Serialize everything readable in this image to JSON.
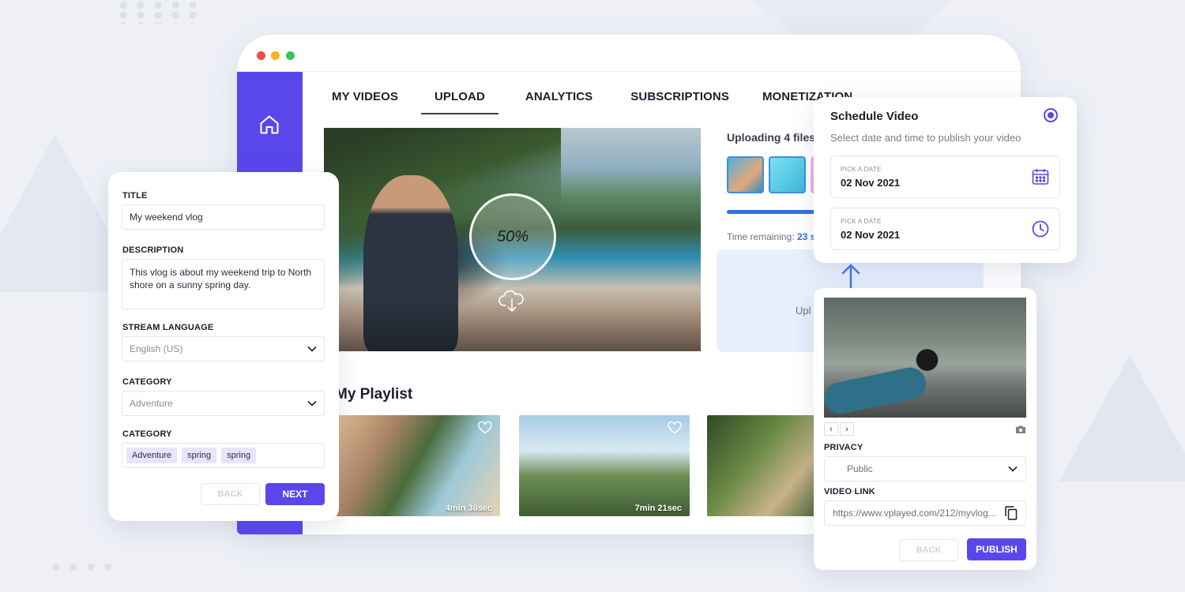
{
  "window": {
    "tabs": [
      {
        "label": "MY VIDEOS"
      },
      {
        "label": "UPLOAD"
      },
      {
        "label": "ANALYTICS"
      },
      {
        "label": "SUBSCRIPTIONS"
      },
      {
        "label": "MONETIZATION"
      }
    ],
    "active_tab": "UPLOAD"
  },
  "upload": {
    "progress_label": "50%",
    "progress": 0.5,
    "status_title": "Uploading 4 files",
    "time_remaining_label": "Time remaining:",
    "time_remaining_value": "23 s",
    "drop_zone_text": "Upl"
  },
  "playlist": {
    "title": "My Playlist",
    "items": [
      {
        "duration": "4min 36sec"
      },
      {
        "duration": "7min 21sec"
      },
      {
        "duration": ""
      }
    ]
  },
  "form": {
    "title_label": "TITLE",
    "title_value": "My weekend vlog",
    "description_label": "DESCRIPTION",
    "description_value": "This vlog is about my weekend trip to North shore on a sunny spring day.",
    "language_label": "STREAM LANGUAGE",
    "language_value": "English (US)",
    "category_label": "CATEGORY",
    "category_value": "Adventure",
    "tags_label": "CATEGORY",
    "tags": [
      "Adventure",
      "spring",
      "spring"
    ],
    "back_label": "BACK",
    "next_label": "NEXT"
  },
  "schedule": {
    "title": "Schedule Video",
    "subtitle": "Select date and time to publish your video",
    "date_label": "PICK A DATE",
    "date_value": "02 Nov 2021",
    "time_label": "PICK A DATE",
    "time_value": "02 Nov 2021"
  },
  "publish": {
    "prev_label": "‹",
    "next_label": "›",
    "privacy_label": "PRIVACY",
    "privacy_value": "Public",
    "link_label": "VIDEO LINK",
    "link_value": "https://www.vplayed.com/212/myvlog...",
    "back_label": "BACK",
    "publish_label": "PUBLISH"
  },
  "colors": {
    "accent": "#5a47ec",
    "progress_blue": "#3472e0",
    "background": "#eef0f6"
  }
}
